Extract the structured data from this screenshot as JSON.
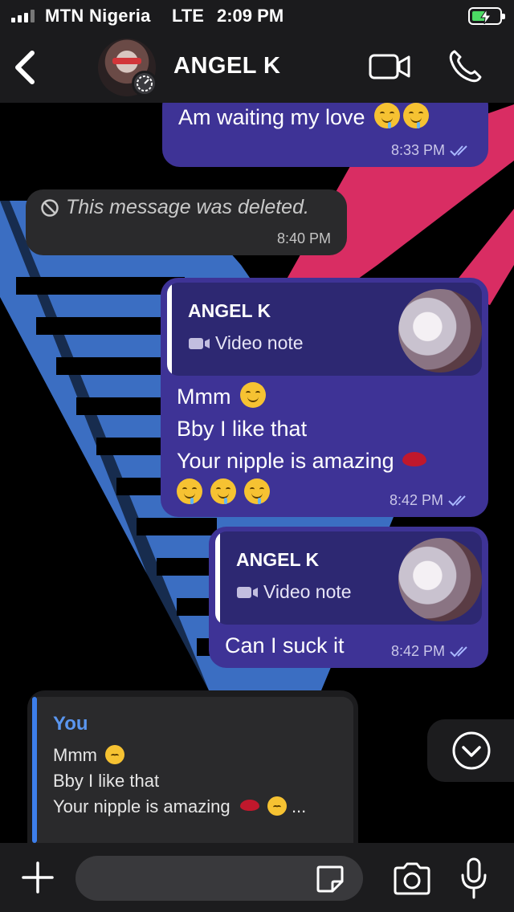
{
  "status_bar": {
    "carrier": "MTN Nigeria",
    "network": "LTE",
    "time": "2:09 PM",
    "battery_charging": true
  },
  "header": {
    "contact_name": "ANGEL K",
    "icons": [
      "back-chevron-icon",
      "disappearing-timer-icon",
      "video-camera-icon",
      "phone-icon"
    ]
  },
  "messages": [
    {
      "direction": "out",
      "text": "Am waiting my love",
      "emojis": [
        "drooling-face",
        "drooling-face"
      ],
      "time": "8:33 PM",
      "read": true
    },
    {
      "direction": "in",
      "deleted": true,
      "text": "This message was deleted.",
      "time": "8:40 PM"
    },
    {
      "direction": "out",
      "quote": {
        "author": "ANGEL K",
        "type": "Video note"
      },
      "lines": [
        "Mmm",
        "Bby I like that",
        "Your nipple is amazing"
      ],
      "emojis": [
        "savoring-face",
        "kiss-mark",
        "drooling-face",
        "drooling-face",
        "drooling-face"
      ],
      "time": "8:42 PM",
      "read": true
    },
    {
      "direction": "out",
      "quote": {
        "author": "ANGEL K",
        "type": "Video note"
      },
      "text": "Can I suck it",
      "time": "8:42 PM",
      "read": true
    }
  ],
  "reply_preview": {
    "author": "You",
    "lines": [
      "Mmm",
      "Bby I like that",
      "Your nipple is amazing"
    ],
    "ellipsis": "..."
  },
  "input_bar": {
    "placeholder": "",
    "icons": [
      "plus-icon",
      "sticker-icon",
      "camera-icon",
      "microphone-icon"
    ]
  },
  "colors": {
    "outgoing_bubble": "#3e3396",
    "incoming_bubble": "#2a2a2c",
    "reply_accent": "#5a96f0",
    "background": "#000000"
  }
}
